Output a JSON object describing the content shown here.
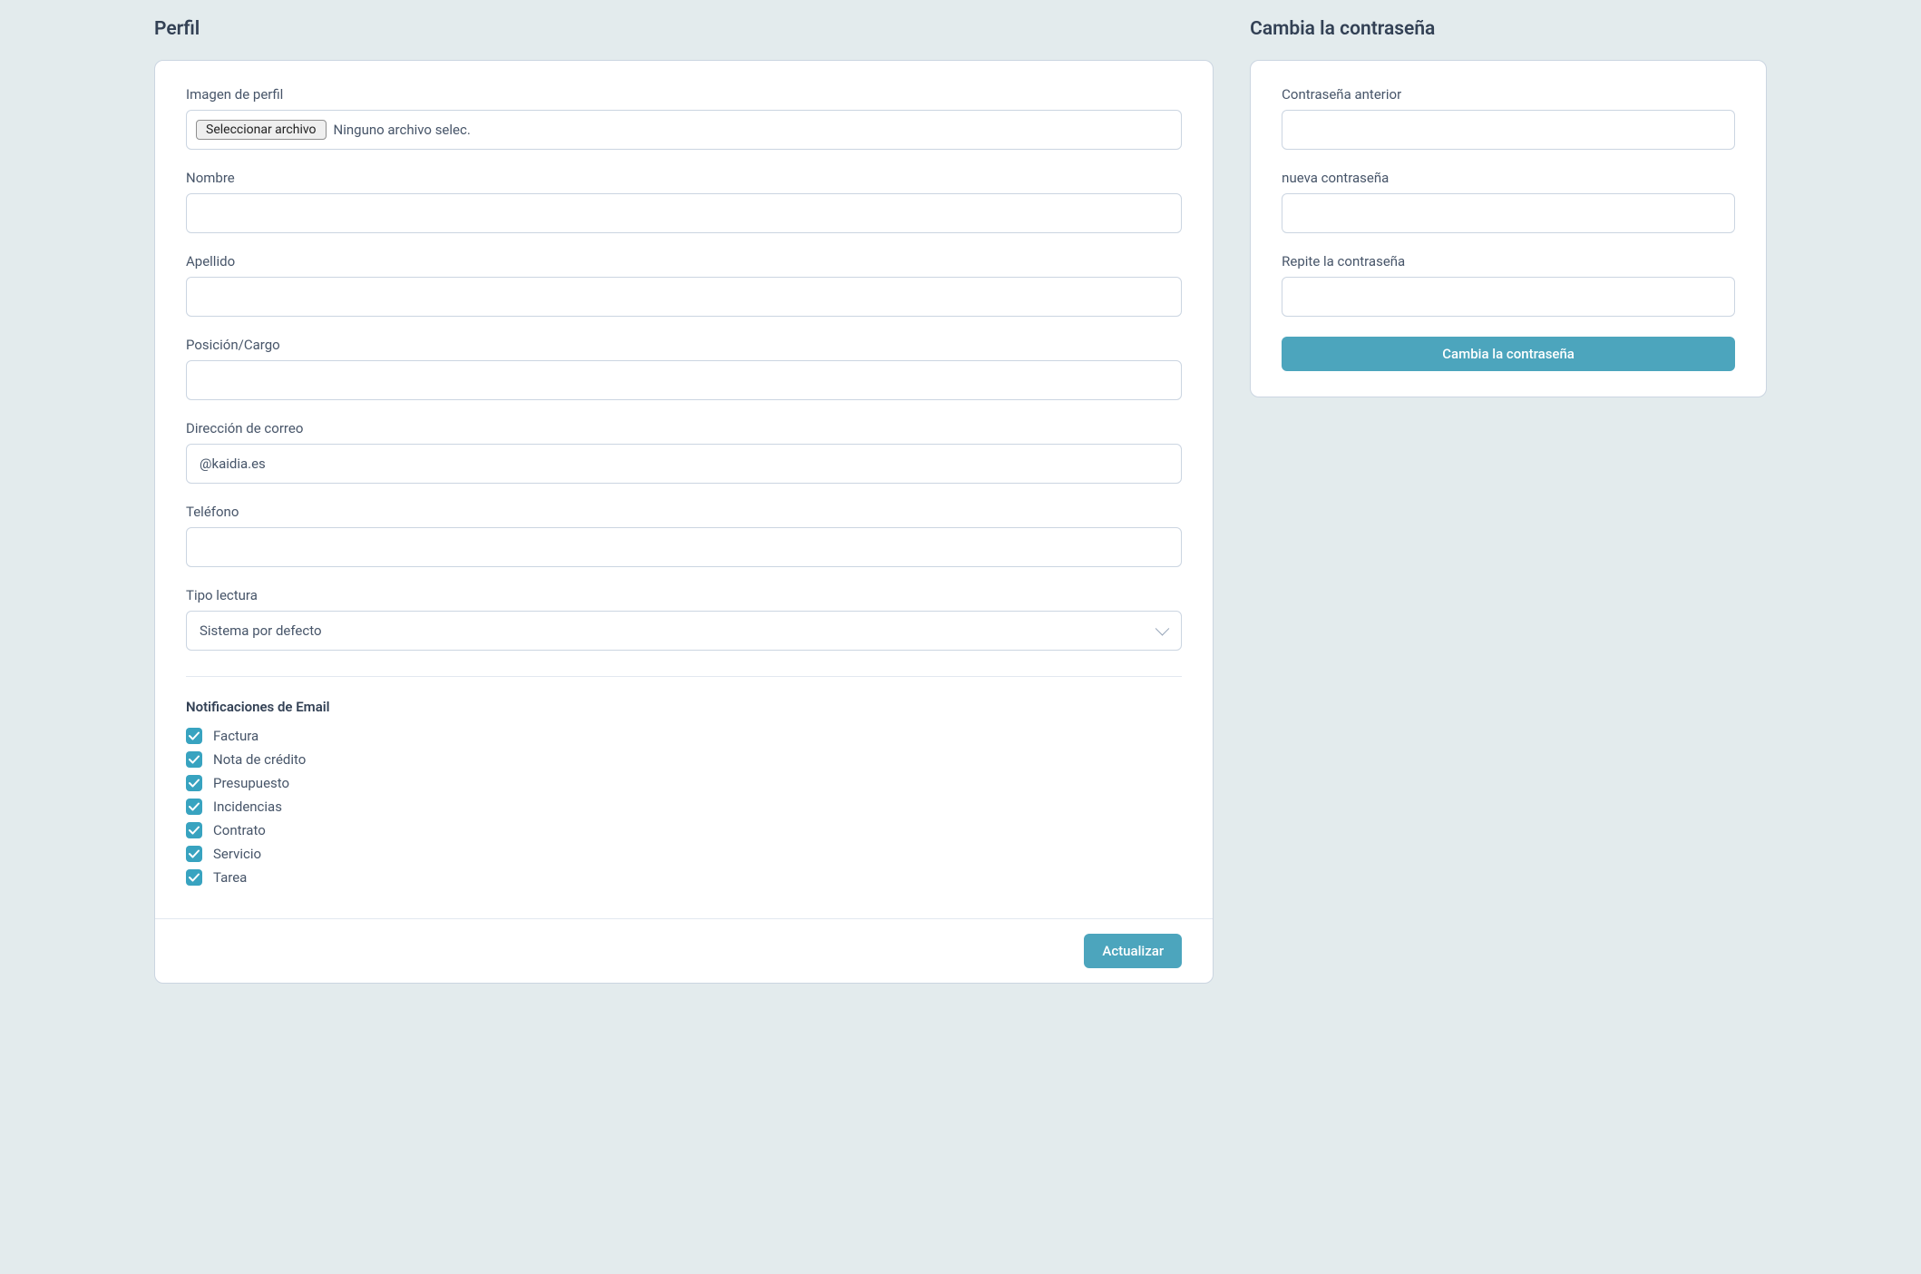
{
  "profile": {
    "title": "Perfil",
    "fields": {
      "profile_image": {
        "label": "Imagen de perfil",
        "button_text": "Seleccionar archivo",
        "status_text": "Ninguno archivo selec."
      },
      "first_name": {
        "label": "Nombre",
        "value": ""
      },
      "last_name": {
        "label": "Apellido",
        "value": ""
      },
      "position": {
        "label": "Posición/Cargo",
        "value": ""
      },
      "email": {
        "label": "Dirección de correo",
        "value": "@kaidia.es"
      },
      "phone": {
        "label": "Teléfono",
        "value": ""
      },
      "reading_type": {
        "label": "Tipo lectura",
        "selected": "Sistema por defecto"
      }
    },
    "notifications": {
      "title": "Notificaciones de Email",
      "items": [
        {
          "label": "Factura",
          "checked": true
        },
        {
          "label": "Nota de crédito",
          "checked": true
        },
        {
          "label": "Presupuesto",
          "checked": true
        },
        {
          "label": "Incidencias",
          "checked": true
        },
        {
          "label": "Contrato",
          "checked": true
        },
        {
          "label": "Servicio",
          "checked": true
        },
        {
          "label": "Tarea",
          "checked": true
        }
      ]
    },
    "submit_label": "Actualizar"
  },
  "password": {
    "title": "Cambia la contraseña",
    "fields": {
      "old": {
        "label": "Contraseña anterior",
        "value": ""
      },
      "new": {
        "label": "nueva contraseña",
        "value": ""
      },
      "repeat": {
        "label": "Repite la contraseña",
        "value": ""
      }
    },
    "submit_label": "Cambia la contraseña"
  }
}
